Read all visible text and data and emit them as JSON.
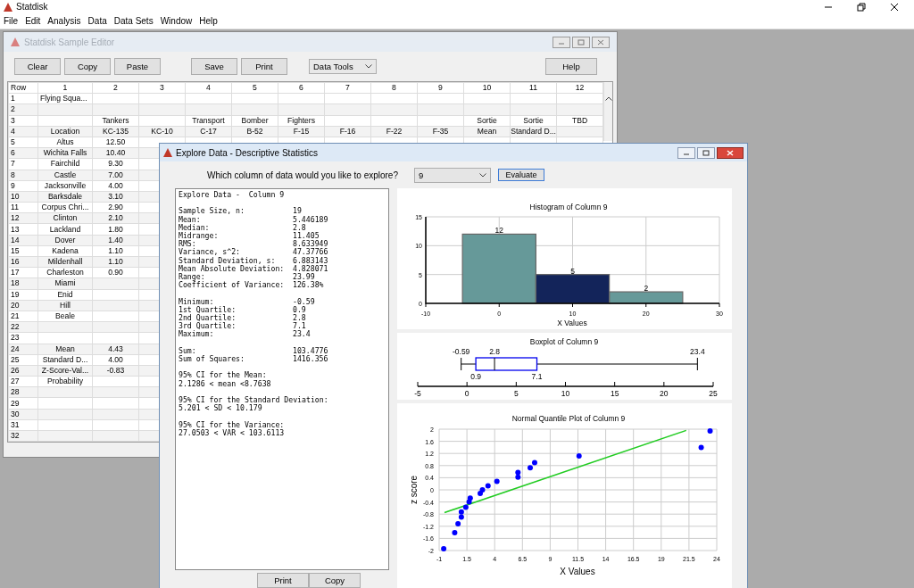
{
  "app": {
    "title": "Statdisk"
  },
  "menu": [
    "File",
    "Edit",
    "Analysis",
    "Data",
    "Data Sets",
    "Window",
    "Help"
  ],
  "editor": {
    "title": "Statdisk Sample Editor",
    "buttons": [
      "Clear",
      "Copy",
      "Paste",
      "Save",
      "Print"
    ],
    "tools_dropdown": "Data Tools",
    "help_button": "Help",
    "columns": [
      "Row",
      "1",
      "2",
      "3",
      "4",
      "5",
      "6",
      "7",
      "8",
      "9",
      "10",
      "11",
      "12"
    ],
    "rows": [
      {
        "row": "1",
        "cells": [
          "Flying Squa..."
        ]
      },
      {
        "row": "2"
      },
      {
        "row": "3",
        "cells": [
          null,
          "Tankers",
          null,
          "Transport",
          "Bomber",
          "Fighters",
          null,
          null,
          null,
          "Sortie",
          "Sortie",
          "TBD"
        ]
      },
      {
        "row": "4",
        "cells": [
          "Location",
          "KC-135",
          "KC-10",
          "C-17",
          "B-52",
          "F-15",
          "F-16",
          "F-22",
          "F-35",
          "Mean",
          "Standard D..."
        ]
      },
      {
        "row": "5",
        "cells": [
          "Altus",
          "12.50"
        ]
      },
      {
        "row": "6",
        "cells": [
          "Wichita Falls",
          "10.40"
        ]
      },
      {
        "row": "7",
        "cells": [
          "Fairchild",
          "9.30"
        ]
      },
      {
        "row": "8",
        "cells": [
          "Castle",
          "7.00"
        ]
      },
      {
        "row": "9",
        "cells": [
          "Jacksonville",
          "4.00"
        ]
      },
      {
        "row": "10",
        "cells": [
          "Barksdale",
          "3.10"
        ]
      },
      {
        "row": "11",
        "cells": [
          "Corpus Chri...",
          "2.90"
        ]
      },
      {
        "row": "12",
        "cells": [
          "Clinton",
          "2.10"
        ]
      },
      {
        "row": "13",
        "cells": [
          "Lackland",
          "1.80"
        ]
      },
      {
        "row": "14",
        "cells": [
          "Dover",
          "1.40"
        ]
      },
      {
        "row": "15",
        "cells": [
          "Kadena",
          "1.10"
        ]
      },
      {
        "row": "16",
        "cells": [
          "Mildenhall",
          "1.10"
        ]
      },
      {
        "row": "17",
        "cells": [
          "Charleston",
          "0.90"
        ]
      },
      {
        "row": "18",
        "cells": [
          "Miami"
        ]
      },
      {
        "row": "19",
        "cells": [
          "Enid"
        ]
      },
      {
        "row": "20",
        "cells": [
          "Hill"
        ]
      },
      {
        "row": "21",
        "cells": [
          "Beale"
        ]
      },
      {
        "row": "22"
      },
      {
        "row": "23"
      },
      {
        "row": "24",
        "cells": [
          "Mean",
          "4.43"
        ]
      },
      {
        "row": "25",
        "cells": [
          "Standard D...",
          "4.00"
        ]
      },
      {
        "row": "26",
        "cells": [
          "Z-Score-Val...",
          "-0.83"
        ]
      },
      {
        "row": "27",
        "cells": [
          "Probability"
        ]
      },
      {
        "row": "28"
      },
      {
        "row": "29"
      },
      {
        "row": "30"
      },
      {
        "row": "31"
      },
      {
        "row": "32"
      }
    ]
  },
  "explore": {
    "title": "Explore Data - Descriptive Statistics",
    "question": "Which column of data would you like to explore?",
    "column_select": "9",
    "evaluate_button": "Evaluate",
    "report": {
      "heading": "Explore Data -  Column 9",
      "blocks": [
        [
          {
            "label": "Sample Size, n:",
            "value": "19"
          },
          {
            "label": "Mean:",
            "value": "5.446189"
          },
          {
            "label": "Median:",
            "value": "2.8"
          },
          {
            "label": "Midrange:",
            "value": "11.405"
          },
          {
            "label": "RMS:",
            "value": "8.633949"
          },
          {
            "label": "Variance, s^2:",
            "value": "47.37766"
          },
          {
            "label": "Standard Deviation, s:",
            "value": "6.883143"
          },
          {
            "label": "Mean Absolute Deviation:",
            "value": "4.828071"
          },
          {
            "label": "Range:",
            "value": "23.99"
          },
          {
            "label": "Coefficient of Variance:",
            "value": "126.38%"
          }
        ],
        [
          {
            "label": "Minimum:",
            "value": "-0.59"
          },
          {
            "label": "1st Quartile:",
            "value": "0.9"
          },
          {
            "label": "2nd Quartile:",
            "value": "2.8"
          },
          {
            "label": "3rd Quartile:",
            "value": "7.1"
          },
          {
            "label": "Maximum:",
            "value": "23.4"
          }
        ],
        [
          {
            "label": "Sum:",
            "value": "103.4776"
          },
          {
            "label": "Sum of Squares:",
            "value": "1416.356"
          }
        ],
        [
          {
            "label": "95% CI for the Mean:"
          },
          {
            "label": "2.1286 < mean <8.7638"
          }
        ],
        [
          {
            "label": "95% CI for the Standard Deviation:"
          },
          {
            "label": "5.201 < SD < 10.179"
          }
        ],
        [
          {
            "label": "95% CI for the Variance:"
          },
          {
            "label": "27.0503 < VAR < 103.6113"
          }
        ]
      ]
    },
    "histogram": {
      "chart_data": {
        "type": "bar",
        "title": "Histogram of Column 9",
        "xlabel": "X Values",
        "x": [
          0,
          10,
          20
        ],
        "data_labels": true,
        "grid": true,
        "series": [
          {
            "color": "#669999",
            "values": [
              12,
              null,
              2
            ]
          },
          {
            "color": "#13245a",
            "values": [
              null,
              5,
              null
            ]
          }
        ],
        "xlim": [
          -10,
          30
        ],
        "ylim": [
          0,
          15
        ],
        "xticks": [
          -10,
          0,
          10,
          20,
          30
        ],
        "yticks": [
          0,
          5,
          10,
          15
        ]
      }
    },
    "boxplot": {
      "title": "Boxplot of Column 9",
      "min": "-0.59",
      "q1": "0.9",
      "median": "2.8",
      "q3": "7.1",
      "max": "23.4",
      "ticks": [
        "-5",
        "0",
        "5",
        "10",
        "15",
        "20",
        "25"
      ]
    },
    "quantile_plot": {
      "chart_data": {
        "type": "scatter",
        "title": "Normal Quantile Plot of Column 9",
        "xlabel": "X Values",
        "ylabel": "z score",
        "grid": true,
        "x": [
          -0.59,
          0.4,
          0.7,
          1.0,
          1.0,
          1.4,
          1.7,
          1.8,
          2.7,
          2.9,
          3.4,
          4.2,
          6.1,
          6.1,
          7.2,
          7.6,
          11.6,
          22.6,
          23.4
        ],
        "series": [
          {
            "color": "#0000ff",
            "values": [
              -1.94,
              -1.41,
              -1.12,
              -0.9,
              -0.73,
              -0.57,
              -0.4,
              -0.27,
              -0.12,
              0,
              0.13,
              0.28,
              0.42,
              0.57,
              0.73,
              0.9,
              1.12,
              1.4,
              1.94
            ]
          },
          {
            "type": "line",
            "color": "#22cc22",
            "x": [
              -0.52,
              21.25
            ],
            "values": [
              -0.75,
              1.96
            ]
          }
        ],
        "xlim": [
          -1,
          24
        ],
        "ylim": [
          -2,
          2
        ],
        "xticks": [
          -1,
          1.5,
          4,
          6.5,
          9,
          11.5,
          14,
          16.5,
          19,
          21.5,
          24
        ],
        "yticks": [
          -2,
          -1.6,
          -1.2,
          -0.8,
          -0.4,
          0,
          0.4,
          0.8,
          1.2,
          1.6,
          2
        ]
      }
    },
    "bottom_buttons": [
      "Print",
      "Copy"
    ]
  }
}
